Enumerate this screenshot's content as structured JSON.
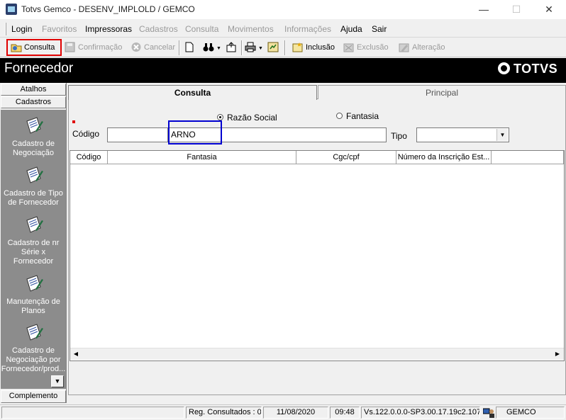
{
  "window": {
    "title": "Totvs Gemco - DESENV_IMPLOLD / GEMCO",
    "minimize": "—",
    "maximize": "☐",
    "close": "✕"
  },
  "menubar": {
    "items": [
      "Login",
      "Favoritos",
      "Impressoras",
      "Cadastros",
      "Consulta",
      "Movimentos",
      "Informações",
      "Ajuda",
      "Sair"
    ]
  },
  "toolbar": {
    "consulta": "Consulta",
    "confirmacao": "Confirmação",
    "cancelar": "Cancelar",
    "inclusao": "Inclusão",
    "exclusao": "Exclusão",
    "alteracao": "Alteração"
  },
  "header": {
    "page_title": "Fornecedor",
    "logo_text": "TOTVS"
  },
  "leftpanel": {
    "atalhos": "Atalhos",
    "cadastros": "Cadastros",
    "complemento": "Complemento",
    "items": [
      "Cadastro de Negociação",
      "Cadastro de Tipo de Fornecedor",
      "Cadastro de nr Série x Fornecedor",
      "Manutenção de Planos",
      "Cadastro de Negociação por Fornecedor/prod..."
    ]
  },
  "tabs": {
    "consulta": "Consulta",
    "principal": "Principal"
  },
  "form": {
    "radio_razao_social": "Razão Social",
    "radio_fantasia": "Fantasia",
    "codigo_label": "Código",
    "codigo_value": "",
    "razao_social_value": "ARNO",
    "tipo_label": "Tipo",
    "tipo_value": ""
  },
  "grid": {
    "columns": [
      "Código",
      "Fantasia",
      "Cgc/cpf",
      "Número da Inscrição Est...",
      ""
    ]
  },
  "status": {
    "reg_consultados": "Reg. Consultados : 0",
    "date": "11/08/2020",
    "time": "09:48",
    "version": "Vs.122.0.0.0-SP3.00.17.19c2.107",
    "company": "GEMCO"
  },
  "colors": {
    "highlight_red": "#e00000",
    "highlight_blue": "#0000d0",
    "header_bg": "#000000",
    "left_list_bg": "#8c8c8c"
  }
}
